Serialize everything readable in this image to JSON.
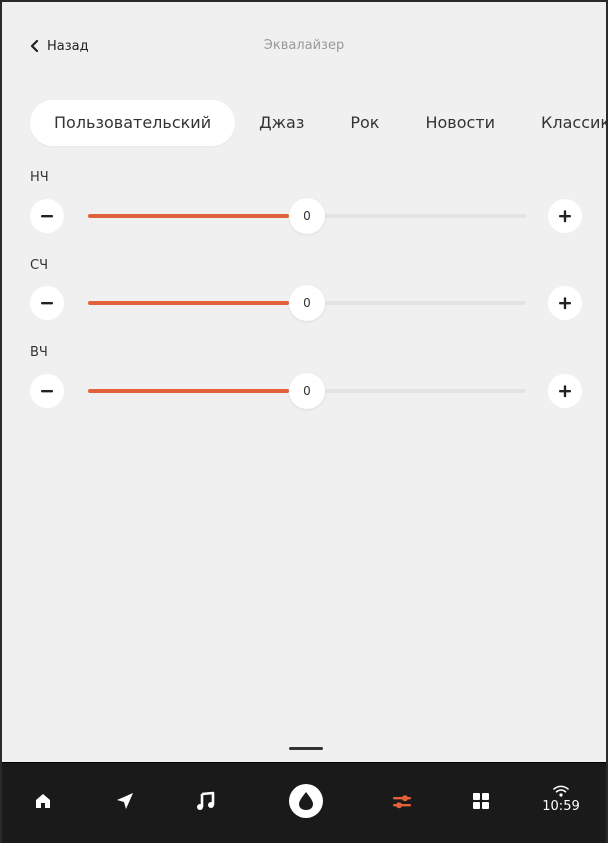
{
  "header": {
    "back_label": "Назад",
    "title": "Эквалайзер"
  },
  "presets": [
    {
      "label": "Пользовательский",
      "active": true
    },
    {
      "label": "Джаз",
      "active": false
    },
    {
      "label": "Рок",
      "active": false
    },
    {
      "label": "Новости",
      "active": false
    },
    {
      "label": "Классика",
      "active": false
    }
  ],
  "bands": [
    {
      "label": "НЧ",
      "value": "0",
      "level_fraction": 0.5
    },
    {
      "label": "СЧ",
      "value": "0",
      "level_fraction": 0.5
    },
    {
      "label": "ВЧ",
      "value": "0",
      "level_fraction": 0.5
    }
  ],
  "colors": {
    "accent": "#e2603a",
    "background": "#f0f0f0",
    "navbar": "#1a1a1a"
  },
  "navbar": {
    "items": [
      {
        "icon": "home-icon"
      },
      {
        "icon": "navigation-arrow-icon"
      },
      {
        "icon": "music-note-icon"
      },
      {
        "icon": "voice-assistant-icon"
      },
      {
        "icon": "equalizer-icon",
        "active": true
      },
      {
        "icon": "apps-grid-icon"
      }
    ],
    "wifi_icon": "wifi-icon",
    "time": "10:59"
  }
}
